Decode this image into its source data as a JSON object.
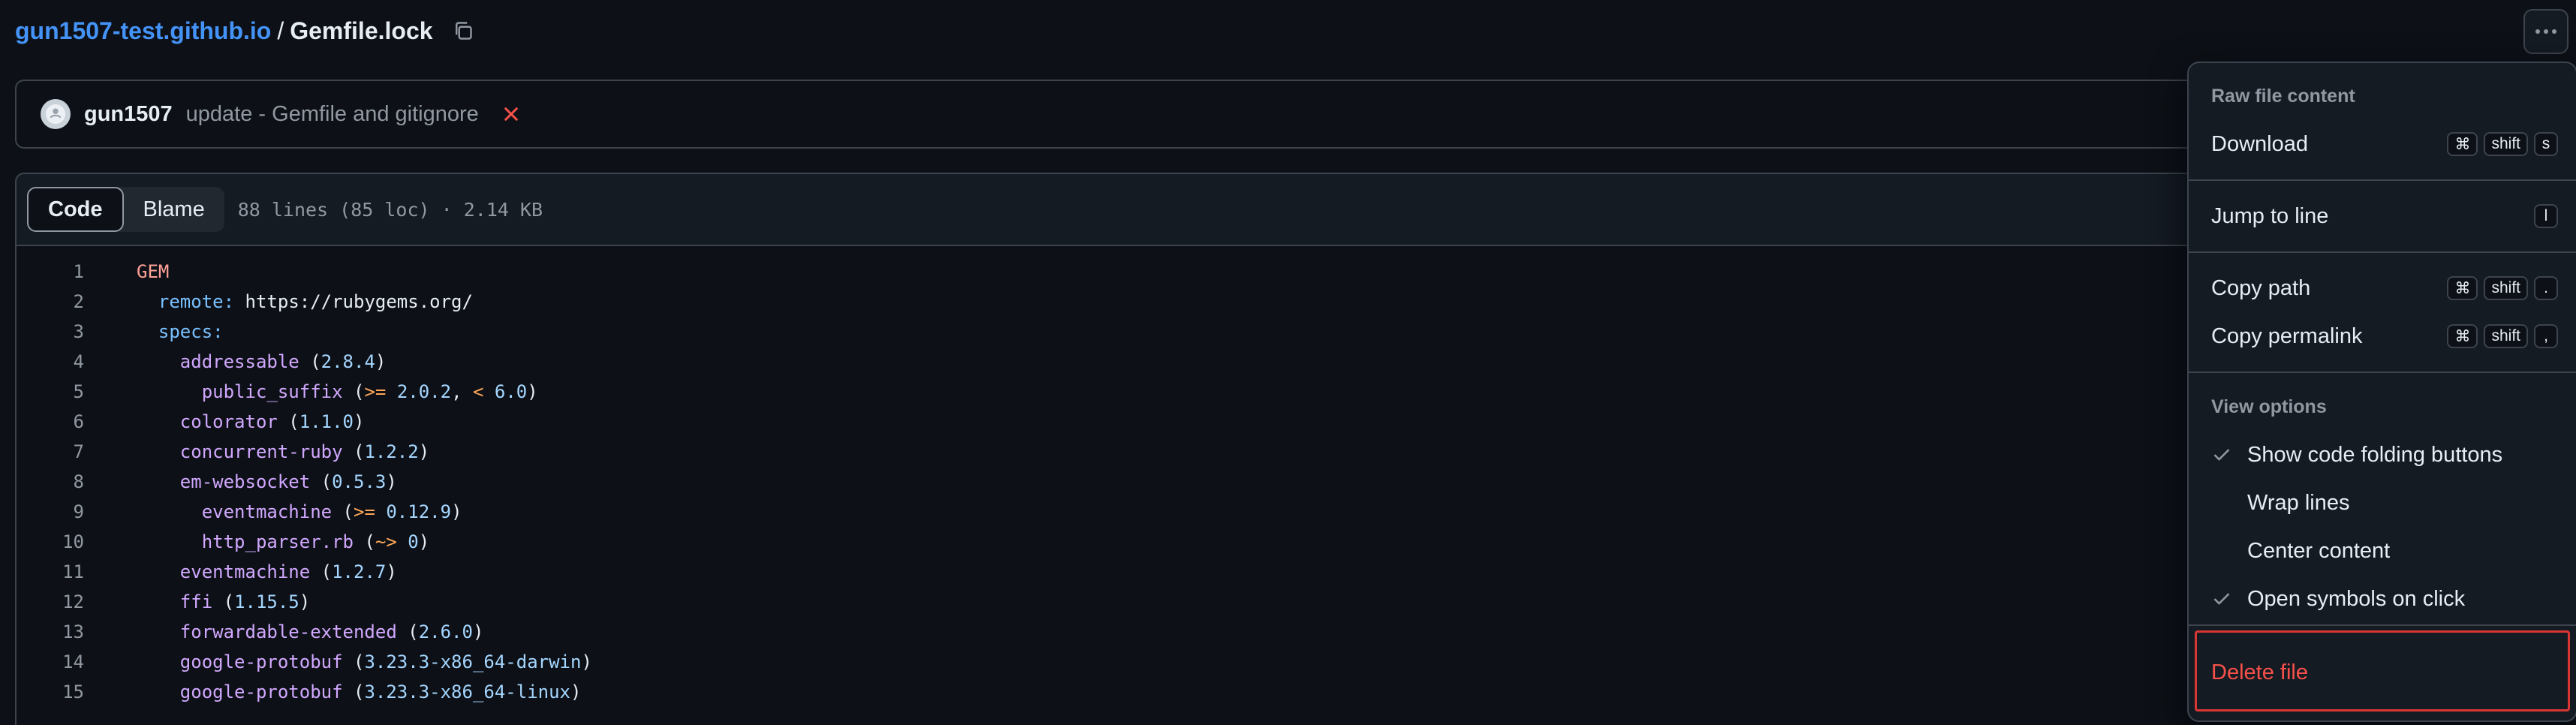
{
  "breadcrumb": {
    "repo": "gun1507-test.github.io",
    "separator": "/",
    "file": "Gemfile.lock"
  },
  "commit": {
    "author": "gun1507",
    "message": "update - Gemfile and gitignore",
    "status_color": "#f85149"
  },
  "file_header": {
    "tabs": [
      {
        "label": "Code",
        "active": true
      },
      {
        "label": "Blame",
        "active": false
      }
    ],
    "meta": "88 lines (85 loc) · 2.14 KB"
  },
  "code_lines": [
    {
      "n": "1",
      "text": "GEM"
    },
    {
      "n": "2",
      "text": "  remote: https://rubygems.org/"
    },
    {
      "n": "3",
      "text": "  specs:"
    },
    {
      "n": "4",
      "text": "    addressable (2.8.4)"
    },
    {
      "n": "5",
      "text": "      public_suffix (>= 2.0.2, < 6.0)"
    },
    {
      "n": "6",
      "text": "    colorator (1.1.0)"
    },
    {
      "n": "7",
      "text": "    concurrent-ruby (1.2.2)"
    },
    {
      "n": "8",
      "text": "    em-websocket (0.5.3)"
    },
    {
      "n": "9",
      "text": "      eventmachine (>= 0.12.9)"
    },
    {
      "n": "10",
      "text": "      http_parser.rb (~> 0)"
    },
    {
      "n": "11",
      "text": "    eventmachine (1.2.7)"
    },
    {
      "n": "12",
      "text": "    ffi (1.15.5)"
    },
    {
      "n": "13",
      "text": "    forwardable-extended (2.6.0)"
    },
    {
      "n": "14",
      "text": "    google-protobuf (3.23.3-x86_64-darwin)"
    },
    {
      "n": "15",
      "text": "    google-protobuf (3.23.3-x86_64-linux)"
    }
  ],
  "menu": {
    "raw_label": "Raw file content",
    "download": {
      "label": "Download",
      "keys": [
        "⌘",
        "shift",
        "s"
      ]
    },
    "jump": {
      "label": "Jump to line",
      "keys": [
        "l"
      ]
    },
    "copy_path": {
      "label": "Copy path",
      "keys": [
        "⌘",
        "shift",
        "."
      ]
    },
    "copy_permalink": {
      "label": "Copy permalink",
      "keys": [
        "⌘",
        "shift",
        ","
      ]
    },
    "view_label": "View options",
    "view_options": [
      {
        "label": "Show code folding buttons",
        "checked": true
      },
      {
        "label": "Wrap lines",
        "checked": false
      },
      {
        "label": "Center content",
        "checked": false
      },
      {
        "label": "Open symbols on click",
        "checked": true
      }
    ],
    "delete": {
      "label": "Delete file"
    }
  },
  "icons": {
    "copy": "copy-icon",
    "kebab": "kebab-horizontal-icon",
    "check": "check-icon",
    "x": "x-icon"
  },
  "colors": {
    "link": "#4493f8",
    "danger": "#f85149",
    "bg": "#0d1117"
  }
}
